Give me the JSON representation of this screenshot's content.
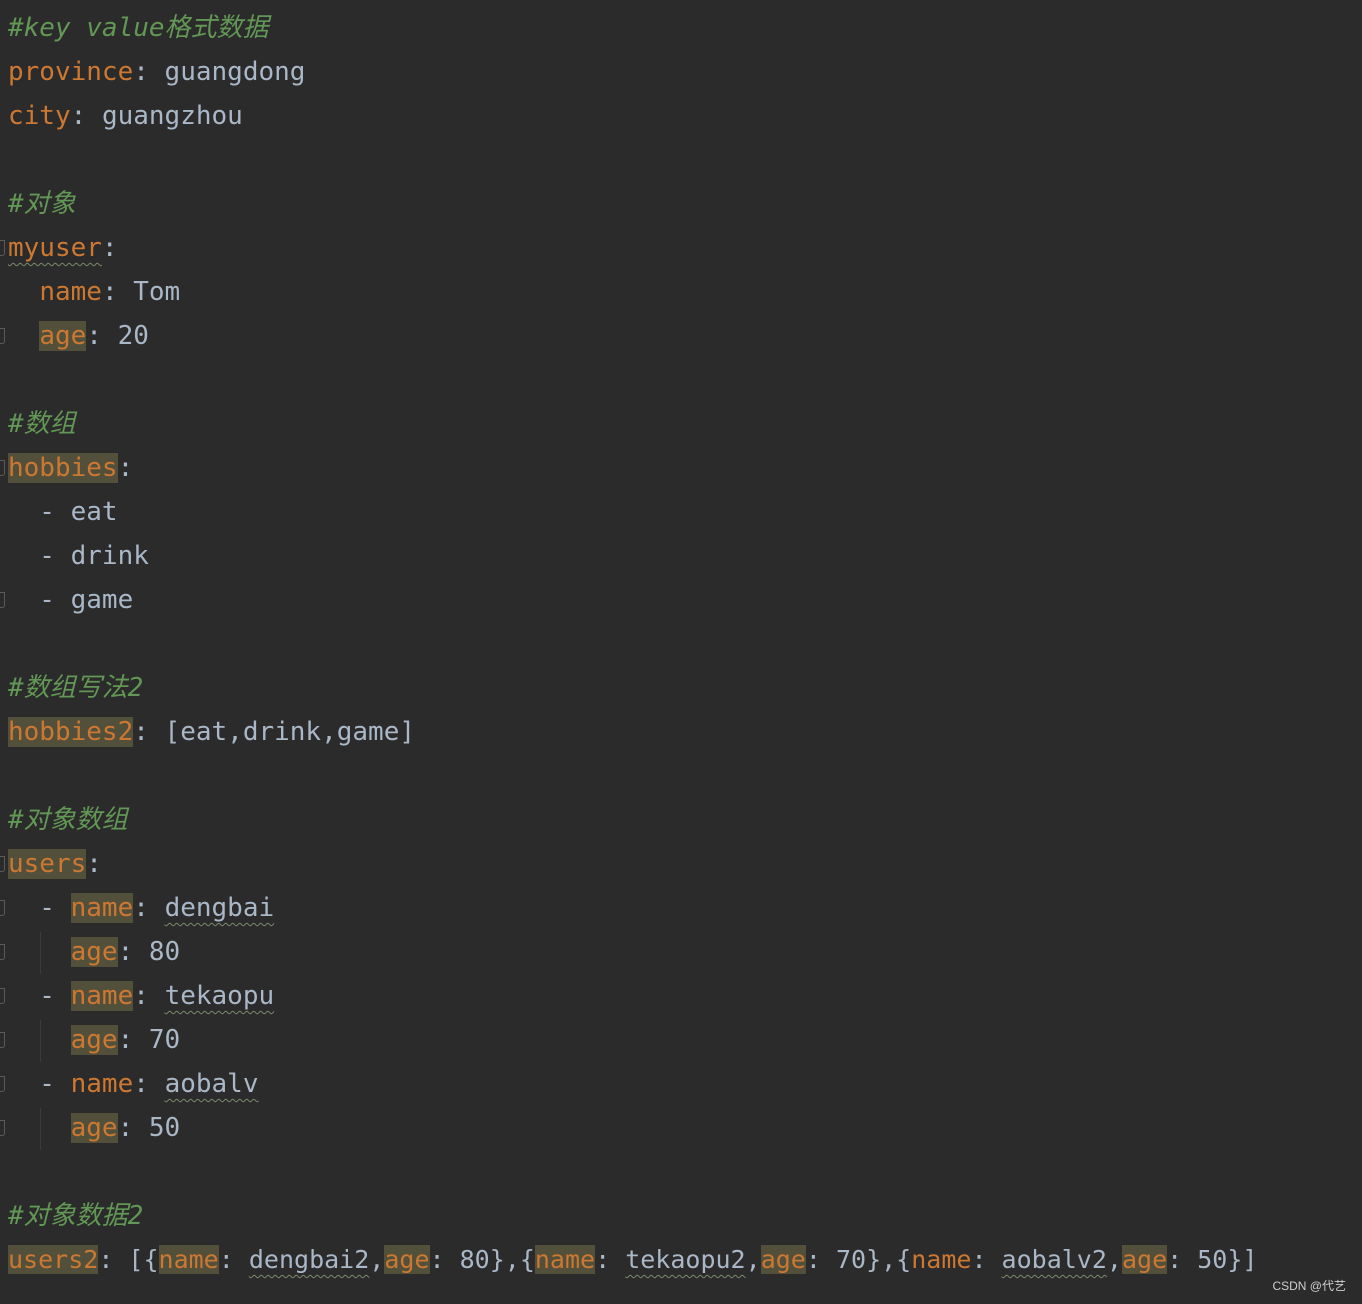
{
  "editor": {
    "c1": "#key value格式数据",
    "l_province_key": "province",
    "l_province_val": "guangdong",
    "l_city_key": "city",
    "l_city_val": "guangzhou",
    "c2": "#对象",
    "l_myuser_key": "myuser",
    "l_myname_key": "name",
    "l_myname_val": "Tom",
    "l_myage_key": "age",
    "l_myage_val": "20",
    "c3": "#数组",
    "l_hobbies_key": "hobbies",
    "l_h1": "eat",
    "l_h2": "drink",
    "l_h3": "game",
    "c4": "#数组写法2",
    "l_hobbies2_key": "hobbies2",
    "l_hobbies2_val": "[eat,drink,game]",
    "c5": "#对象数组",
    "l_users_key": "users",
    "u1_name_key": "name",
    "u1_name_val": "dengbai",
    "u1_age_key": "age",
    "u1_age_val": "80",
    "u2_name_key": "name",
    "u2_name_val": "tekaopu",
    "u2_age_key": "age",
    "u2_age_val": "70",
    "u3_name_key": "name",
    "u3_name_val": "aobalv",
    "u3_age_key": "age",
    "u3_age_val": "50",
    "c6": "#对象数据2",
    "l_users2_key": "users2",
    "u2a_name": "name",
    "u2a_nameval": "dengbai2",
    "u2a_age": "age",
    "u2a_ageval": "80",
    "u2b_name": "name",
    "u2b_nameval": "tekaopu2",
    "u2b_age": "age",
    "u2b_ageval": "70",
    "u2c_name": "name",
    "u2c_nameval": "aobalv2",
    "u2c_age": "age",
    "u2c_ageval": "50"
  },
  "watermark": "CSDN @代艺",
  "colors": {
    "background": "#2b2b2b",
    "comment": "#629755",
    "key": "#cc7832",
    "value": "#a9b7c6",
    "highlight": "#52503a"
  }
}
